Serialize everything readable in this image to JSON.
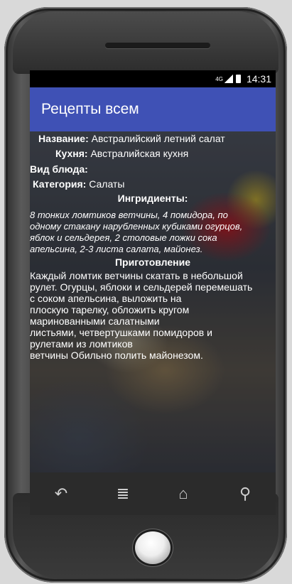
{
  "status": {
    "network": "4G",
    "time": "14:31"
  },
  "app": {
    "title": "Рецепты всем"
  },
  "recipe": {
    "name_label": "Название:",
    "name_value": "Австралийский летний салат",
    "cuisine_label": "Кухня:",
    "cuisine_value": "Австралийская кухня",
    "dish_type_label": "Вид блюда:",
    "dish_type_value": "",
    "category_label": "Категория:",
    "category_value": "Салаты",
    "ingredients_header": "Ингридиенты:",
    "ingredients_lines": [
      "8 тонких ломтиков ветчины, 4 помидора, по",
      "одному стакану нарубленных кубиками огурцов,",
      "яблок и сельдерея, 2 столовые ложки сока",
      "апельсина, 2-3 листа салата, майонез."
    ],
    "preparation_header": "Приготовление",
    "preparation_lines": [
      "Каждый ломтик ветчины скатать в небольшой",
      "рулет. Огурцы, яблоки и сельдерей перемешать",
      "с соком апельсина, выложить на",
      "плоскую тарелку, обложить кругом",
      "маринованными салатными",
      "листьями, четвертушками помидоров и",
      "рулетами из ломтиков",
      "ветчины Обильно полить майонезом."
    ]
  },
  "navbar": {
    "icons": [
      "back-icon",
      "menu-icon",
      "home-icon",
      "search-icon"
    ],
    "symbols": [
      "↶",
      "≣",
      "⌂",
      "⚲"
    ]
  }
}
